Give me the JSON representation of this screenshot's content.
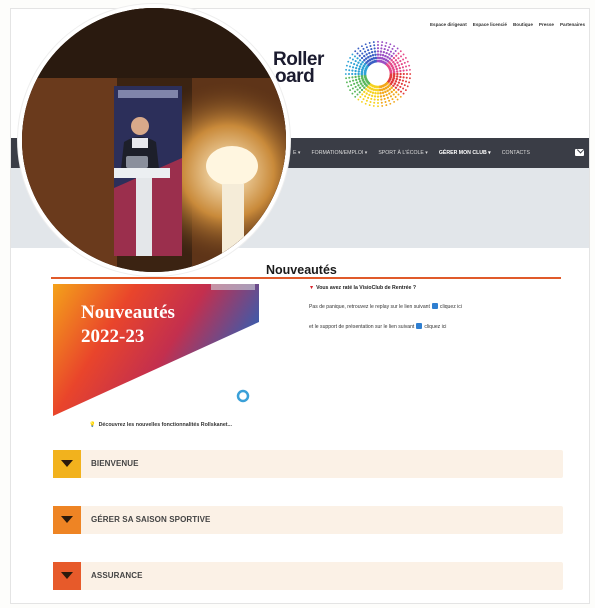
{
  "top_links": [
    "Espace dirigeant",
    "Espace licencié",
    "Boutique",
    "Presse",
    "Partenaires"
  ],
  "logo": {
    "line1": "Roller",
    "line2": "oard"
  },
  "nav": {
    "items": [
      {
        "label": "E ▾",
        "active": false
      },
      {
        "label": "FORMATION/EMPLOI ▾",
        "active": false
      },
      {
        "label": "SPORT À L'ÉCOLE ▾",
        "active": false
      },
      {
        "label": "GÉRER MON CLUB ▾",
        "active": true
      },
      {
        "label": "CONTACTS",
        "active": false
      }
    ],
    "icon": "mail-icon"
  },
  "section": {
    "title": "Nouveautés"
  },
  "banner": {
    "line1": "Nouveautés",
    "line2": "2022-23",
    "caption": "Découvrez les nouvelles fonctionnalités Rollskanet..."
  },
  "news": {
    "headline": "Vous avez raté la VisioClub de Rentrée ?",
    "line1_pre": "Pas de panique, retrouvez le replay sur le lien suivant",
    "line1_link": "cliquez ici",
    "line2_pre": "et le support de présentation sur le lien suivant",
    "line2_link": "cliquez ici"
  },
  "accordion": [
    {
      "label": "BIENVENUE",
      "color": "#f2b21d"
    },
    {
      "label": "GÉRER SA SAISON SPORTIVE",
      "color": "#ee8424"
    },
    {
      "label": "ASSURANCE",
      "color": "#e75a2a"
    }
  ],
  "colors": {
    "accent": "#e05a2a",
    "nav_bg": "#3a3d46",
    "accordion_bg": "#fbf1e6"
  }
}
